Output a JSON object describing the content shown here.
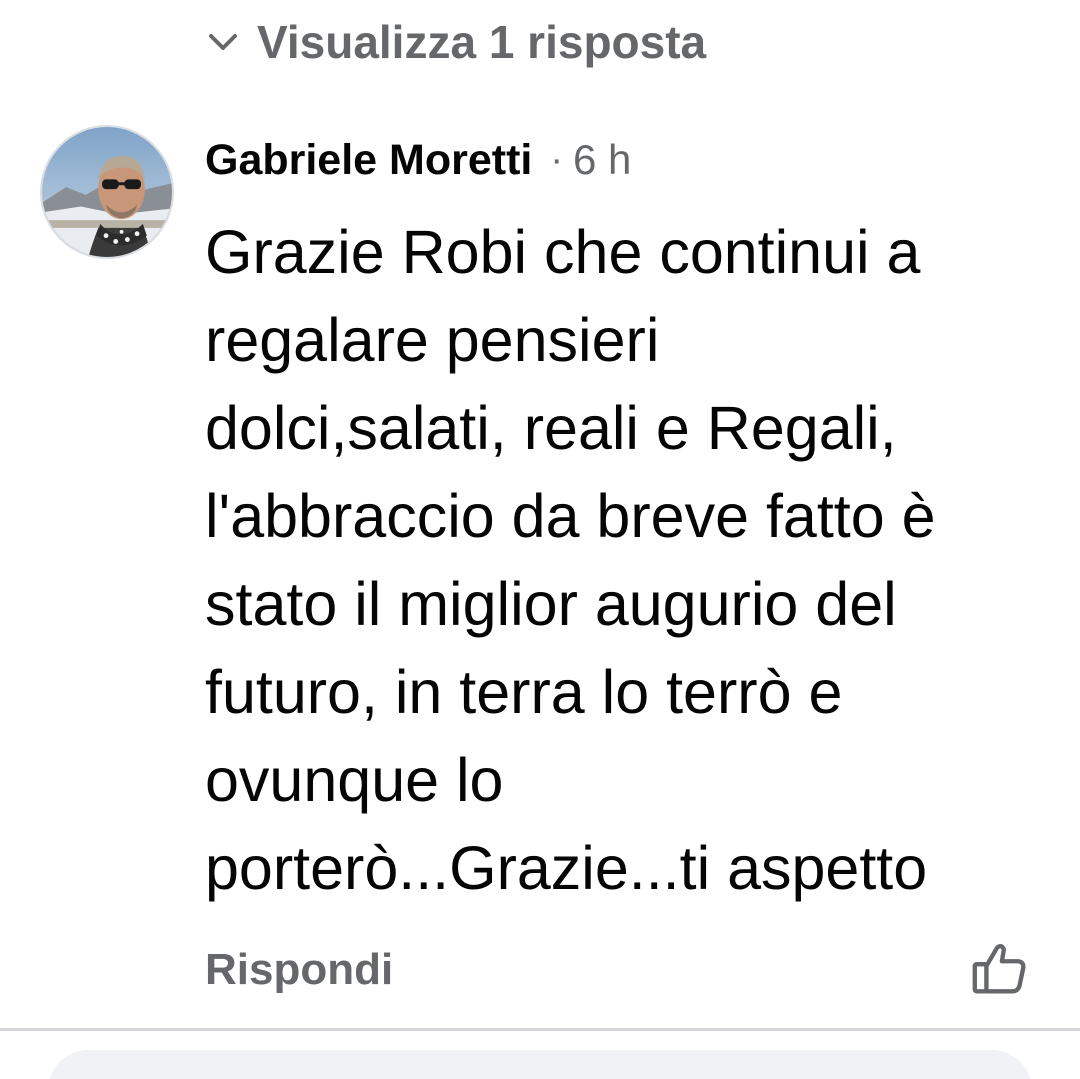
{
  "replies_toggle": {
    "icon": "chevron-down-icon",
    "label": "Visualizza 1 risposta"
  },
  "comment": {
    "avatar_icon": "user-avatar",
    "author": "Gabriele Moretti",
    "separator": "·",
    "time": "6 h",
    "text_lines": [
      "Grazie Robi che continui a",
      "regalare pensieri",
      "dolci,salati, reali e Regali,",
      "l'abbraccio da breve fatto è",
      "stato il miglior augurio del",
      "futuro, in terra lo terrò e",
      "ovunque lo",
      "porterò...Grazie...ti aspetto"
    ],
    "reply_label": "Rispondi",
    "like_icon": "thumbs-up-icon"
  },
  "colors": {
    "secondary_text": "#65676b",
    "primary_text": "#050505",
    "divider": "#d6d7da",
    "composer_bg": "#f0f2f5"
  }
}
